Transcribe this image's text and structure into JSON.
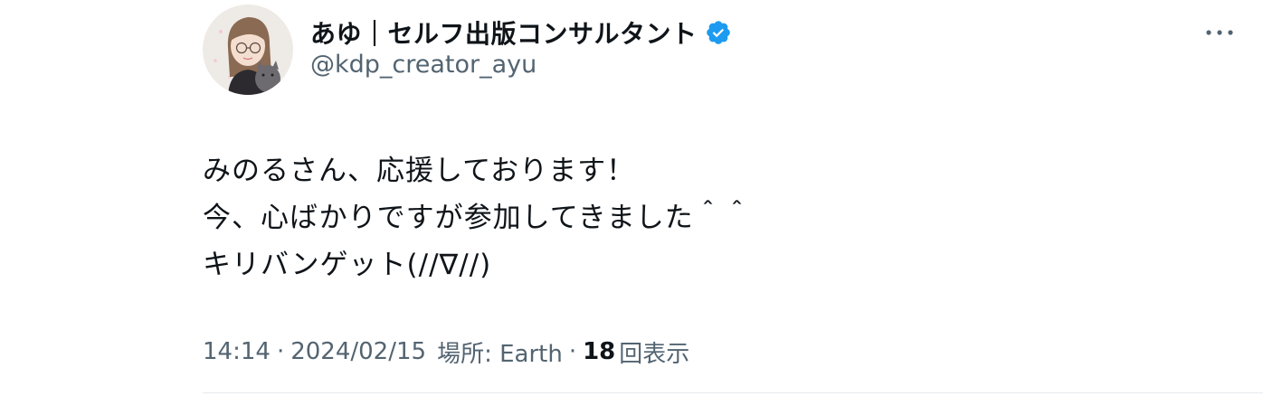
{
  "user": {
    "display_name": "あゆ｜セルフ出版コンサルタント",
    "handle": "@kdp_creator_ayu",
    "verified": true,
    "verified_color": "#1d9bf0",
    "avatar_icon": "illustrated-avatar"
  },
  "more_icon": "more-horizontal-icon",
  "tweet": {
    "lines": [
      "みのるさん、応援しております！",
      "今、心ばかりですが参加してきました＾＾",
      "キリバンゲット(//∇//)"
    ]
  },
  "meta": {
    "time": "14:14",
    "date": "2024/02/15",
    "location": "場所: Earth",
    "views_count": "18",
    "views_label": "回表示",
    "separator": "·"
  },
  "colors": {
    "text_primary": "#0f1419",
    "text_secondary": "#536471",
    "divider": "#e6e9ec"
  }
}
